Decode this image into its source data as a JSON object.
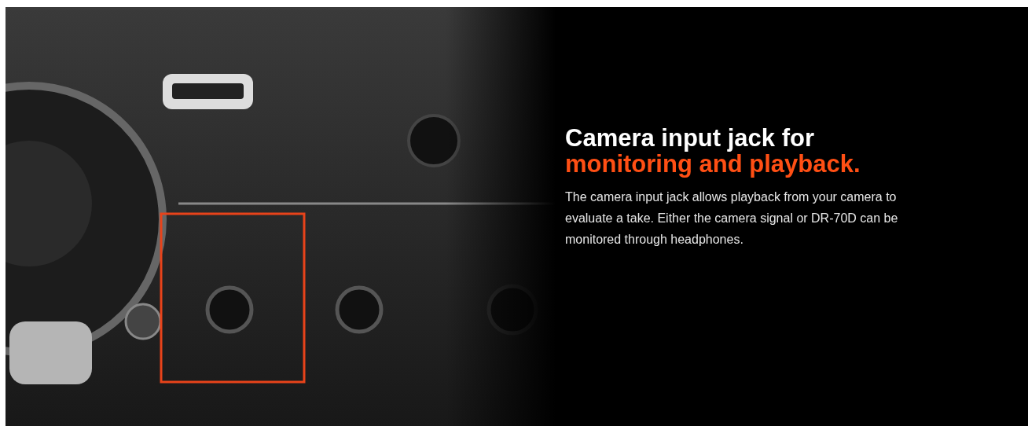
{
  "feature": {
    "title": "Camera input jack for",
    "title_highlight": "monitoring and playback.",
    "description": "The camera input jack allows playback from your camera to evaluate a take. Either the camera signal or DR-70D can be monitored through headphones."
  }
}
